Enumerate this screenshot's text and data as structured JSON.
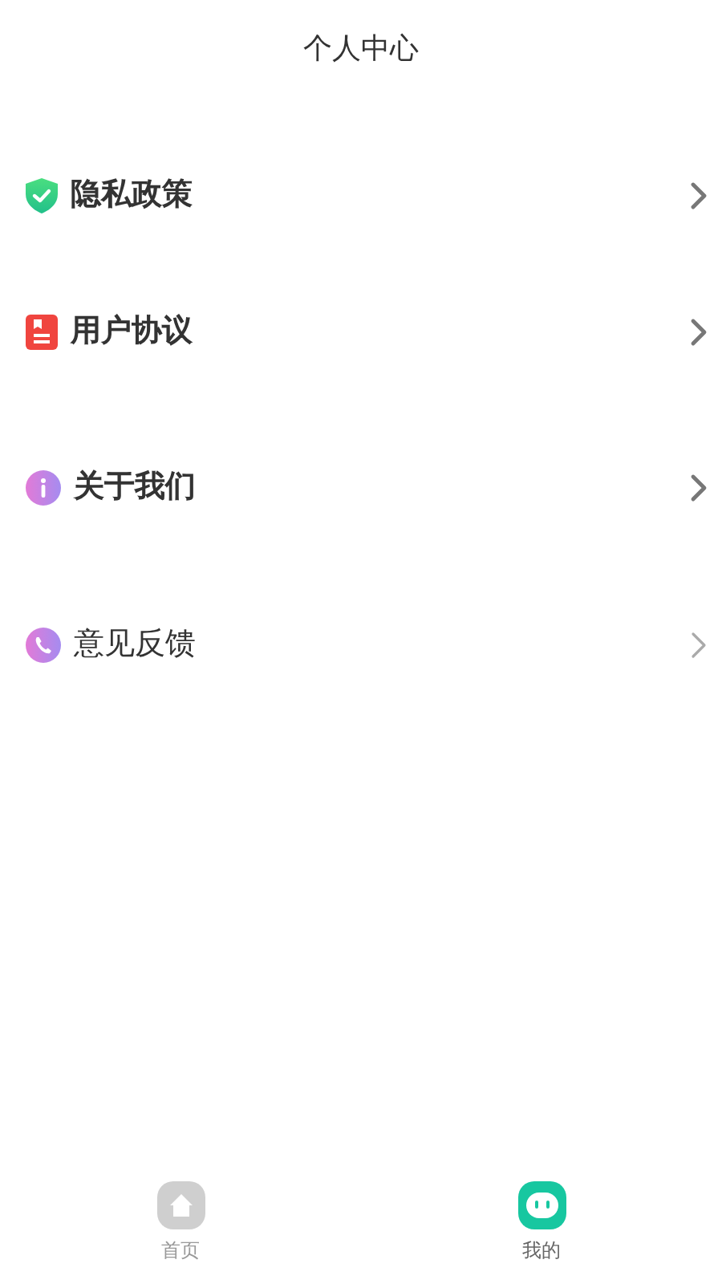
{
  "header": {
    "title": "个人中心"
  },
  "menu": [
    {
      "label": "隐私政策",
      "kind": "shield",
      "bold": true
    },
    {
      "label": "用户协议",
      "kind": "document",
      "bold": true
    },
    {
      "label": "关于我们",
      "kind": "info",
      "bold": true
    },
    {
      "label": "意见反馈",
      "kind": "phone",
      "bold": false
    }
  ],
  "tab_bar": [
    {
      "label": "首页",
      "kind": "home",
      "selected": false
    },
    {
      "label": "我的",
      "kind": "face",
      "selected": true
    }
  ]
}
